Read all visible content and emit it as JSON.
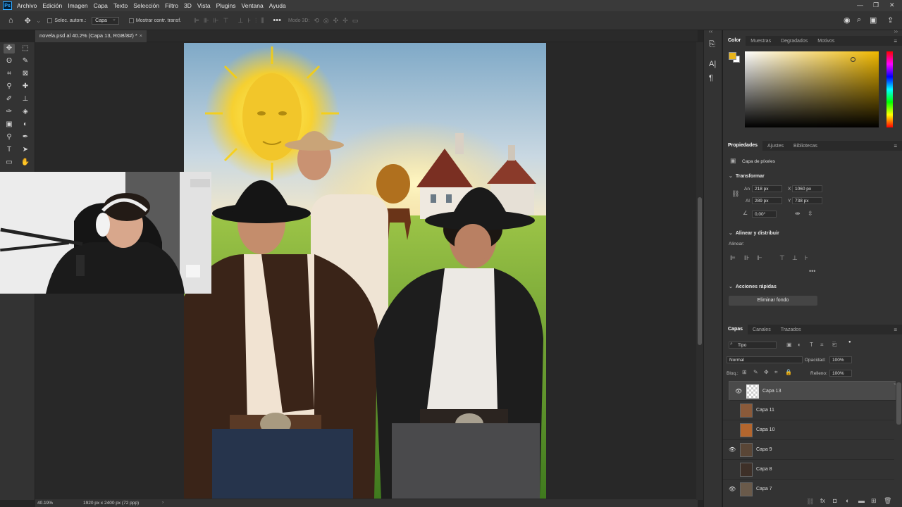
{
  "app": {
    "logo": "Ps"
  },
  "menu": [
    "Archivo",
    "Edición",
    "Imagen",
    "Capa",
    "Texto",
    "Selección",
    "Filtro",
    "3D",
    "Vista",
    "Plugins",
    "Ventana",
    "Ayuda"
  ],
  "options_bar": {
    "auto_select_label": "Selec. autom.:",
    "auto_select_value": "Capa",
    "transform_controls_label": "Mostrar contr. transf.",
    "mode_3d_label": "Modo 3D:"
  },
  "document_tab": {
    "title": "novela.psd al 40.2% (Capa 13, RGB/8#) *",
    "close": "×"
  },
  "status_bar": {
    "zoom": "40.19%",
    "doc_info": "1920 px x 2400 px (72 ppp)"
  },
  "color_panel": {
    "tabs": [
      "Color",
      "Muestras",
      "Degradados",
      "Motivos"
    ],
    "active_tab": "Color",
    "foreground": "#e8b41a",
    "background": "#ffffff",
    "picker_hue": "#f0b800"
  },
  "properties_panel": {
    "tabs": [
      "Propiedades",
      "Ajustes",
      "Bibliotecas"
    ],
    "layer_kind": "Capa de píxeles",
    "transform_title": "Transformar",
    "an_label": "An",
    "an_value": "218 px",
    "x_label": "X",
    "x_value": "1060 px",
    "al_label": "Al",
    "al_value": "289 px",
    "y_label": "Y",
    "y_value": "738 px",
    "angle_value": "0,00°",
    "align_title": "Alinear y distribuir",
    "align_label": "Alinear:",
    "quick_title": "Acciones rápidas",
    "remove_bg": "Eliminar fondo"
  },
  "layers_panel": {
    "tabs": [
      "Capas",
      "Canales",
      "Trazados"
    ],
    "filter_value": "Tipo",
    "blend_mode": "Normal",
    "opacity_label": "Opacidad:",
    "opacity_value": "100%",
    "lock_label": "Bloq.:",
    "fill_label": "Relleno:",
    "fill_value": "100%",
    "layers": [
      {
        "name": "Capa 13",
        "visible": true,
        "selected": true
      },
      {
        "name": "Capa 11",
        "visible": false,
        "selected": false
      },
      {
        "name": "Capa 10",
        "visible": false,
        "selected": false
      },
      {
        "name": "Capa 9",
        "visible": true,
        "selected": false
      },
      {
        "name": "Capa 8",
        "visible": false,
        "selected": false
      },
      {
        "name": "Capa 7",
        "visible": true,
        "selected": false
      }
    ]
  }
}
